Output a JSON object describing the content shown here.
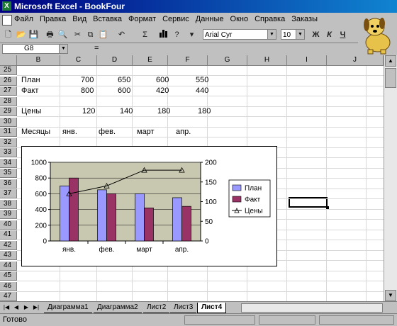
{
  "window": {
    "title": "Microsoft Excel - BookFour"
  },
  "menu": [
    "Файл",
    "Правка",
    "Вид",
    "Вставка",
    "Формат",
    "Сервис",
    "Данные",
    "Окно",
    "Справка",
    "Заказы"
  ],
  "toolbar": {
    "font": "Arial Cyr",
    "size": "10",
    "bold": "Ж",
    "italic": "К",
    "underline": "Ч",
    "sum": "Σ"
  },
  "formula_bar": {
    "name": "G8",
    "eq": "="
  },
  "columns": [
    "B",
    "C",
    "D",
    "E",
    "F",
    "G",
    "H",
    "I",
    "J"
  ],
  "rows": [
    "25",
    "26",
    "27",
    "28",
    "29",
    "30",
    "31",
    "32",
    "33",
    "34",
    "35",
    "36",
    "37",
    "38",
    "39",
    "40",
    "41",
    "42",
    "43",
    "44",
    "45",
    "46",
    "47"
  ],
  "cells": {
    "r26": {
      "label": "План",
      "v": [
        "700",
        "650",
        "600",
        "550"
      ]
    },
    "r27": {
      "label": "Факт",
      "v": [
        "800",
        "600",
        "420",
        "440"
      ]
    },
    "r29": {
      "label": "Цены",
      "v": [
        "120",
        "140",
        "180",
        "180"
      ]
    },
    "r31": {
      "label": "Месяцы",
      "v": [
        "янв.",
        "фев.",
        "март",
        "апр."
      ]
    }
  },
  "chart_data": {
    "type": "bar",
    "categories": [
      "янв.",
      "фев.",
      "март",
      "апр."
    ],
    "series": [
      {
        "name": "План",
        "values": [
          700,
          650,
          600,
          550
        ],
        "color": "#9999ff"
      },
      {
        "name": "Факт",
        "values": [
          800,
          600,
          420,
          440
        ],
        "color": "#993366"
      },
      {
        "name": "Цены",
        "values": [
          120,
          140,
          180,
          180
        ],
        "type": "line",
        "axis": "secondary"
      }
    ],
    "y_ticks": [
      "0",
      "200",
      "400",
      "600",
      "800",
      "1000"
    ],
    "y2_ticks": [
      "0",
      "50",
      "100",
      "150",
      "200"
    ],
    "ylim": [
      0,
      1000
    ],
    "y2lim": [
      0,
      200
    ],
    "legend": "right",
    "legend_labels": [
      "План",
      "Факт",
      "Цены"
    ]
  },
  "sheet_tabs": [
    "Диаграмма1",
    "Диаграмма2",
    "Лист2",
    "Лист3",
    "Лист4"
  ],
  "active_tab": "Лист4",
  "status": "Готово"
}
